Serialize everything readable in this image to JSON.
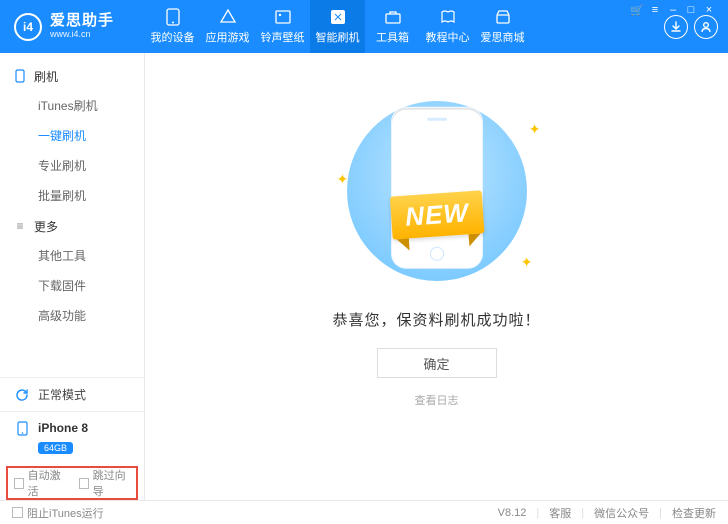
{
  "app": {
    "name": "爱思助手",
    "url": "www.i4.cn",
    "logo_letters": "i4"
  },
  "nav": {
    "items": [
      {
        "label": "我的设备"
      },
      {
        "label": "应用游戏"
      },
      {
        "label": "铃声壁纸"
      },
      {
        "label": "智能刷机"
      },
      {
        "label": "工具箱"
      },
      {
        "label": "教程中心"
      },
      {
        "label": "爱思商城"
      }
    ],
    "active_index": 3
  },
  "header_icons": {
    "download": "download-icon",
    "user": "user-icon"
  },
  "window_buttons": [
    "cart",
    "menu",
    "min",
    "max",
    "close"
  ],
  "sidebar": {
    "sections": [
      {
        "title": "刷机",
        "items": [
          "iTunes刷机",
          "一键刷机",
          "专业刷机",
          "批量刷机"
        ],
        "active_index": 1
      },
      {
        "title": "更多",
        "items": [
          "其他工具",
          "下载固件",
          "高级功能"
        ],
        "active_index": -1
      }
    ],
    "mode": "正常模式",
    "device": {
      "name": "iPhone 8",
      "capacity": "64GB"
    },
    "auto_activate_label": "自动激活",
    "skip_guide_label": "跳过向导"
  },
  "main": {
    "ribbon_text": "NEW",
    "message": "恭喜您，保资料刷机成功啦！",
    "confirm_label": "确定",
    "view_log_label": "查看日志"
  },
  "footer": {
    "block_itunes_label": "阻止iTunes运行",
    "version": "V8.12",
    "links": [
      "客服",
      "微信公众号",
      "检查更新"
    ]
  }
}
